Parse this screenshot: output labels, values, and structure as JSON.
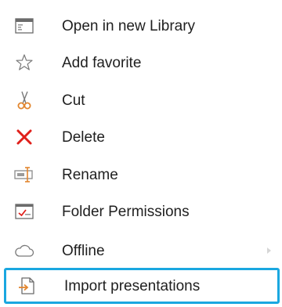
{
  "menu": {
    "items": [
      {
        "label": "Open in new Library",
        "icon": "open-library-icon",
        "has_submenu": false,
        "selected": false
      },
      {
        "label": "Add favorite",
        "icon": "star-outline-icon",
        "has_submenu": false,
        "selected": false
      },
      {
        "label": "Cut",
        "icon": "scissors-icon",
        "has_submenu": false,
        "selected": false
      },
      {
        "label": "Delete",
        "icon": "delete-x-icon",
        "has_submenu": false,
        "selected": false
      },
      {
        "label": "Rename",
        "icon": "rename-icon",
        "has_submenu": false,
        "selected": false
      },
      {
        "label": "Folder Permissions",
        "icon": "folder-permissions-icon",
        "has_submenu": false,
        "selected": false
      },
      {
        "label": "Offline",
        "icon": "cloud-icon",
        "has_submenu": true,
        "selected": false
      },
      {
        "label": "Import presentations",
        "icon": "import-icon",
        "has_submenu": false,
        "selected": true
      }
    ]
  },
  "colors": {
    "text": "#1f1f1f",
    "selection_border": "#1aa7e0",
    "delete_red": "#e0201b",
    "scissors_orange": "#e2862f"
  }
}
